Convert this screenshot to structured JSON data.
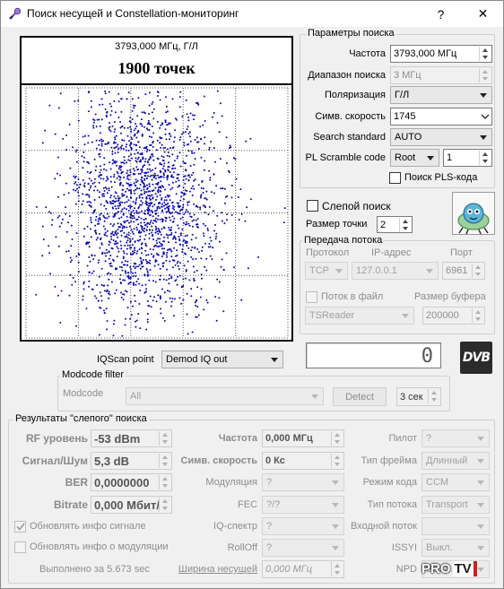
{
  "window": {
    "title": "Поиск несущей и Constellation-мониторинг",
    "help": "?",
    "close": "✕"
  },
  "constellation": {
    "freq_label": "3793,000 МГц, Г/Л",
    "points_label": "1900 точек",
    "point_count": 1900,
    "dot_color": "#0a0ab0"
  },
  "search_params": {
    "title": "Параметры поиска",
    "frequency_label": "Частота",
    "frequency_value": "3793,000 МГц",
    "range_label": "Диапазон поиска",
    "range_value": "3 МГц",
    "polarization_label": "Поляризация",
    "polarization_value": "Г/Л",
    "symrate_label": "Симв. скорость",
    "symrate_value": "1745",
    "standard_label": "Search standard",
    "standard_value": "AUTO",
    "scramble_label": "PL Scramble code",
    "scramble_mode": "Root",
    "scramble_value": "1",
    "pls_search_label": "Поиск PLS-кода"
  },
  "blind": {
    "label": "Слепой поиск"
  },
  "point_size": {
    "label": "Размер точки",
    "value": "2"
  },
  "stream": {
    "title": "Передача потока",
    "protocol_label": "Протокол",
    "ip_label": "IP-адрес",
    "port_label": "Порт",
    "protocol_value": "TCP",
    "ip_value": "127.0.0.1",
    "port_value": "6961",
    "to_file_label": "Поток в файл",
    "buffer_label": "Размер буфера",
    "reader_value": "TSReader",
    "buffer_value": "200000"
  },
  "lcd_value": "0",
  "dvb_logo": "DVB",
  "iqscan": {
    "label": "IQScan point",
    "value": "Demod IQ out"
  },
  "modcode": {
    "title": "Modcode filter",
    "label": "Modcode",
    "value": "All",
    "detect_label": "Detect",
    "interval_value": "3 сек"
  },
  "results": {
    "title": "Результаты \"слепого\" поиска",
    "rf_label": "RF уровень",
    "rf_value": "-53 dBm",
    "snr_label": "Сигнал/Шум",
    "snr_value": "5,3 dB",
    "ber_label": "BER",
    "ber_value": "0,0000000",
    "bitrate_label": "Bitrate",
    "bitrate_value": "0,000 Мбит/",
    "freq_label": "Частота",
    "freq_value": "0,000 МГц",
    "symrate_label": "Симв. скорость",
    "symrate_value": "0 Кс",
    "modulation_label": "Модуляция",
    "modulation_value": "?",
    "fec_label": "FEC",
    "fec_value": "?/?",
    "iq_label": "IQ-спектр",
    "iq_value": "?",
    "rolloff_label": "RollOff",
    "rolloff_value": "?",
    "bandwidth_label": "Ширина несущей",
    "bandwidth_value": "0,000 МГц",
    "pilot_label": "Пилот",
    "pilot_value": "?",
    "frame_label": "Тип фрейма",
    "frame_value": "Длинный",
    "code_label": "Режим кода",
    "code_value": "CCM",
    "stream_type_label": "Тип потока",
    "stream_type_value": "Transport",
    "input_stream_label": "Входной поток",
    "input_stream_value": "",
    "issyi_label": "ISSYI",
    "issyi_value": "Выкл.",
    "npd_label": "NPD",
    "npd_value": "Выкл.",
    "update_signal_label": "Обновлять инфо сигнале",
    "update_mod_label": "Обновлять инфо о модуляции",
    "done_label": "Выполнено за 5.673 sec"
  },
  "watermark": {
    "left": "PRO",
    "right": "TV"
  }
}
